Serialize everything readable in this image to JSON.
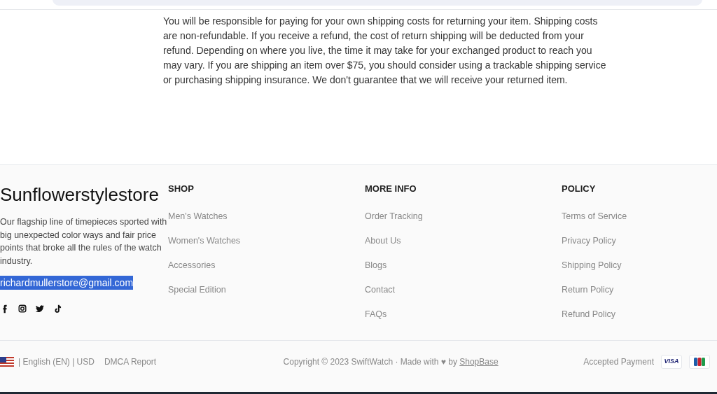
{
  "policy_text": "You will be responsible for paying for your own shipping costs for returning your item. Shipping costs are non-refundable. If you receive a refund, the cost of return shipping will be deducted from your refund. Depending on where you live, the time it may take for your exchanged product to reach you may vary. If you are shipping an item over $75, you should consider using a trackable shipping service or purchasing shipping insurance. We don't guarantee that we will receive your returned item.",
  "footer": {
    "brand": {
      "name": "Sunflowerstylestore",
      "description": "Our flagship line of timepieces sported with big unexpected color ways and fair price points that broke all the rules of the watch industry.",
      "email": {
        "text": "richardmullerstore@gmail.com",
        "highlighted": true
      },
      "social": [
        {
          "kind": "facebook"
        },
        {
          "kind": "instagram"
        },
        {
          "kind": "twitter"
        },
        {
          "kind": "tiktok"
        }
      ]
    },
    "columns": [
      {
        "title": "SHOP",
        "links": [
          "Men's Watches",
          "Women's Watches",
          "Accessories",
          "Special Edition"
        ]
      },
      {
        "title": "MORE INFO",
        "links": [
          "Order Tracking",
          "About Us",
          "Blogs",
          "Contact",
          "FAQs"
        ]
      },
      {
        "title": "POLICY",
        "links": [
          "Terms of Service",
          "Privacy Policy",
          "Shipping Policy",
          "Return Policy",
          "Refund Policy"
        ]
      }
    ],
    "bottom": {
      "locale": "| English (EN) | USD",
      "dmca": "DMCA Report",
      "copyright": "Copyright © 2023 SwiftWatch · Made with ♥ by",
      "copyright_link": "ShopBase",
      "payment_label": "Accepted Payment",
      "payments": [
        {
          "kind": "visa",
          "text": "VISA"
        },
        {
          "kind": "jcb"
        }
      ]
    }
  }
}
